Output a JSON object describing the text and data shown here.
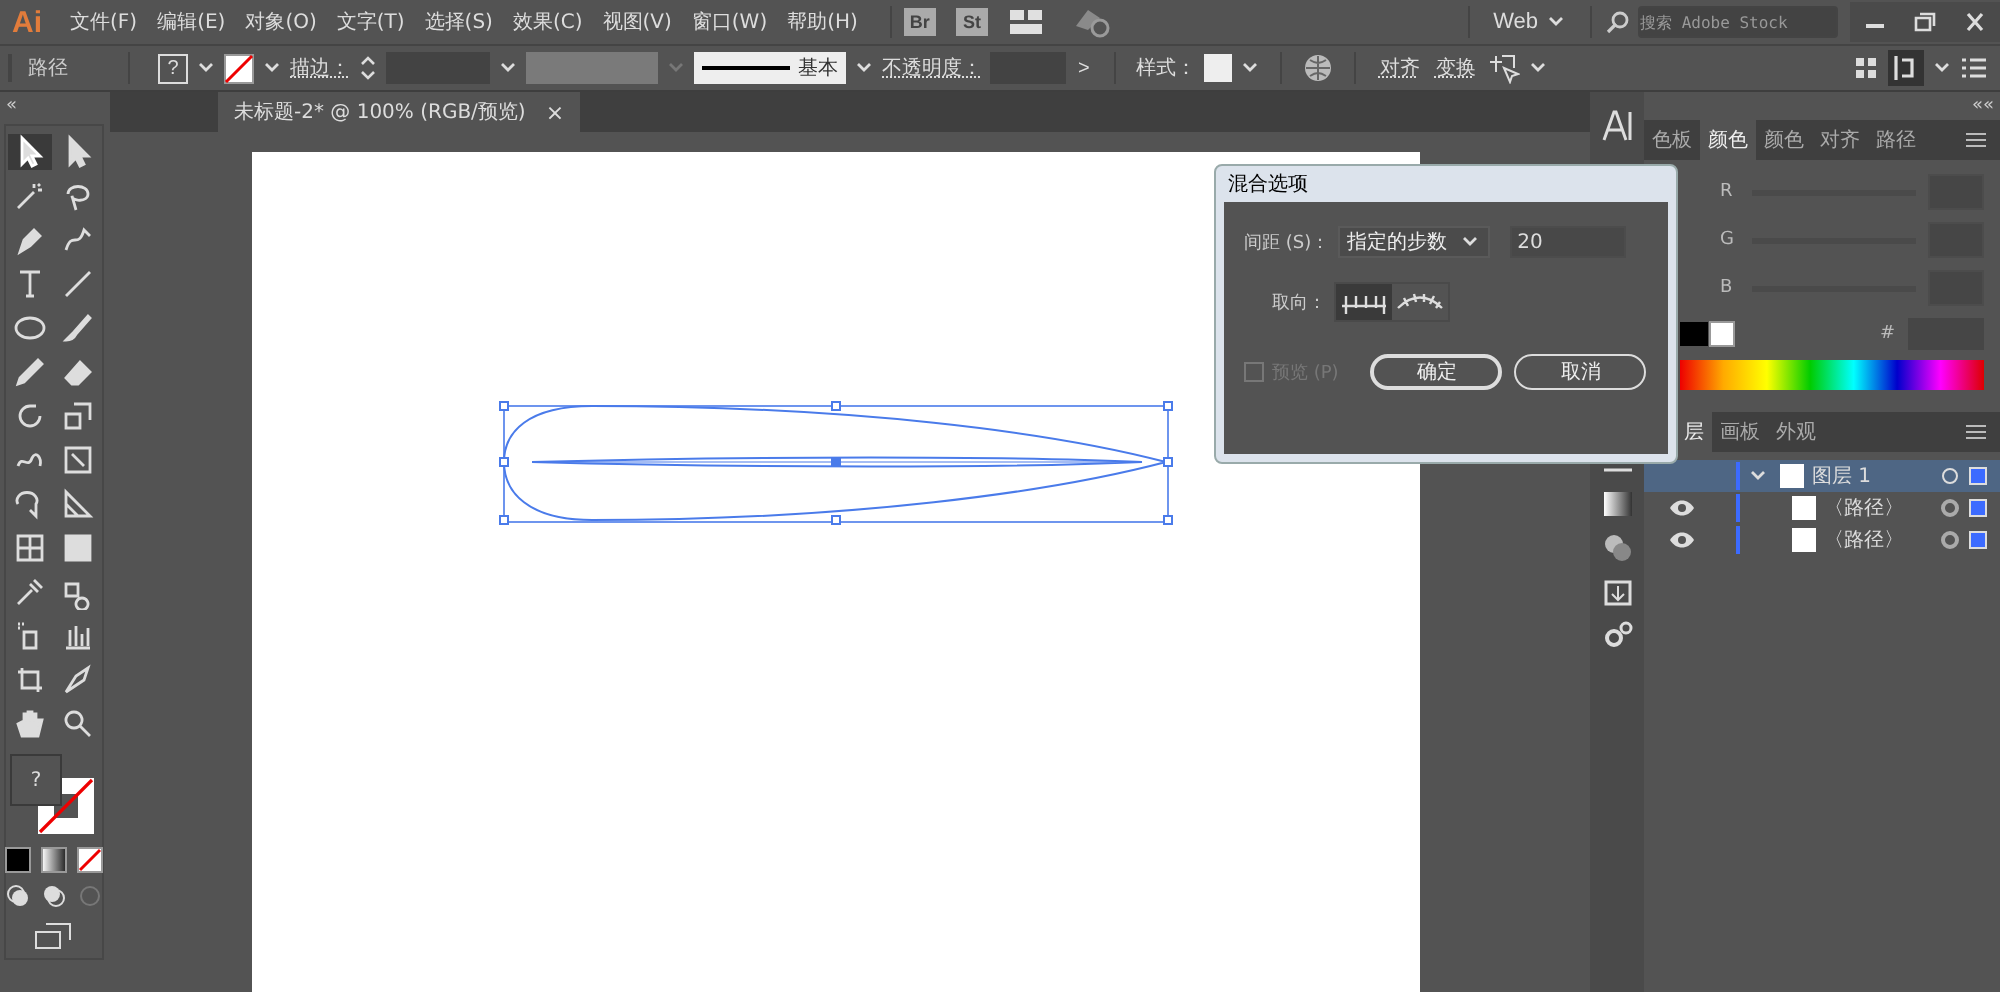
{
  "app": {
    "logo": "Ai",
    "menu": [
      "文件(F)",
      "编辑(E)",
      "对象(O)",
      "文字(T)",
      "选择(S)",
      "效果(C)",
      "视图(V)",
      "窗口(W)",
      "帮助(H)"
    ],
    "bridge_buttons": [
      "Br",
      "St"
    ],
    "workspace": "Web",
    "search": {
      "placeholder": "搜索 Adobe Stock"
    }
  },
  "control_bar": {
    "selection": "路径",
    "fill_symbol": "?",
    "stroke_label": "描边：",
    "stroke_style": "基本",
    "opacity_label": "不透明度：",
    "opacity_arrow": ">",
    "style_label": "样式：",
    "align": "对齐",
    "transform": "变换"
  },
  "document_tab": {
    "title": "未标题-2* @ 100% (RGB/预览)",
    "close": "×"
  },
  "toolbar": {
    "collapse": "«",
    "fill_symbol": "?"
  },
  "dialog": {
    "title": "混合选项",
    "spacing_label": "间距 (S)：",
    "spacing_mode": "指定的步数",
    "steps": "20",
    "orientation_label": "取向：",
    "orientations": [
      {
        "kind": "page",
        "selected": true
      },
      {
        "kind": "path",
        "selected": false
      }
    ],
    "preview": {
      "label": "预览 (P)",
      "checked": false,
      "disabled": true
    },
    "buttons": [
      "确定",
      "取消"
    ]
  },
  "color_panel": {
    "collapse": "««",
    "tabs": [
      {
        "label": "色板",
        "selected": false
      },
      {
        "label": "颜色",
        "selected": true
      },
      {
        "label": "颜色",
        "selected": false
      },
      {
        "label": "对齐",
        "selected": false
      },
      {
        "label": "路径",
        "selected": false
      }
    ],
    "channels": [
      "R",
      "G",
      "B"
    ],
    "hex_label": "#"
  },
  "layers_panel": {
    "tabs": [
      {
        "label": "层",
        "selected": true
      },
      {
        "label": "画板",
        "selected": false
      },
      {
        "label": "外观",
        "selected": false
      }
    ],
    "layers": [
      {
        "name": "图层 1",
        "expanded": true,
        "selected": true,
        "children": [
          {
            "name": "〈路径〉",
            "selected": false
          },
          {
            "name": "〈路径〉",
            "selected": false
          }
        ]
      }
    ]
  }
}
